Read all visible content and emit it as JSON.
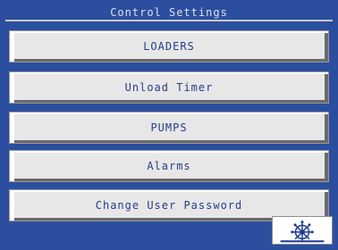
{
  "title": "Control Settings",
  "buttons": [
    {
      "label": "LOADERS"
    },
    {
      "label": "Unload Timer"
    },
    {
      "label": "PUMPS"
    },
    {
      "label": "Alarms"
    },
    {
      "label": "Change User Password"
    }
  ],
  "colors": {
    "background": "#2b4f9e",
    "button_face": "#e7e7e7",
    "button_text": "#2a3b8a",
    "title_text": "#dde3f0"
  },
  "logo_icon": "helm-wheel-icon"
}
